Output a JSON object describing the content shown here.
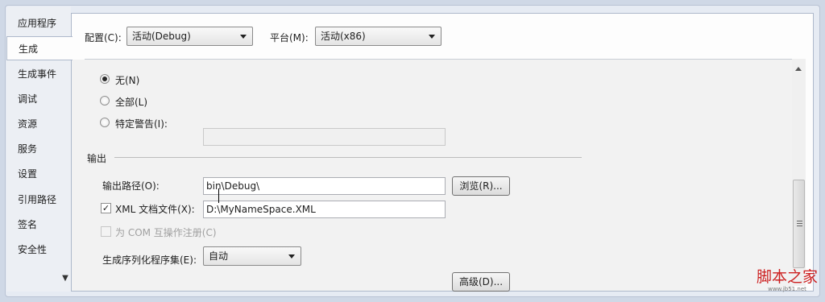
{
  "sidebar": {
    "items": [
      {
        "label": "应用程序"
      },
      {
        "label": "生成"
      },
      {
        "label": "生成事件"
      },
      {
        "label": "调试"
      },
      {
        "label": "资源"
      },
      {
        "label": "服务"
      },
      {
        "label": "设置"
      },
      {
        "label": "引用路径"
      },
      {
        "label": "签名"
      },
      {
        "label": "安全性"
      }
    ],
    "active_index": 1,
    "more_glyph": "▼"
  },
  "topbar": {
    "config_label": "配置(C):",
    "config_value": "活动(Debug)",
    "platform_label": "平台(M):",
    "platform_value": "活动(x86)"
  },
  "warnings": {
    "none_label": "无(N)",
    "all_label": "全部(L)",
    "specific_label": "特定警告(I):",
    "specific_value": ""
  },
  "output": {
    "section_title": "输出",
    "path_label": "输出路径(O):",
    "path_value": "bin\\Debug\\",
    "browse_label": "浏览(R)...",
    "xml_doc_label": "XML 文档文件(X):",
    "xml_doc_checked": true,
    "xml_doc_value": "D:\\MyNameSpace.XML",
    "com_interop_label": "为 COM 互操作注册(C)",
    "serialization_label": "生成序列化程序集(E):",
    "serialization_value": "自动",
    "advanced_label": "高级(D)..."
  },
  "watermark": {
    "title": "脚本之家",
    "url": "www.jb51.net"
  },
  "colors": {
    "panel_bg": "#fdfdfd",
    "content_bg": "#f2f2f2",
    "sidebar_bg": "#eceff4",
    "watermark_red": "#cc1f1f"
  }
}
